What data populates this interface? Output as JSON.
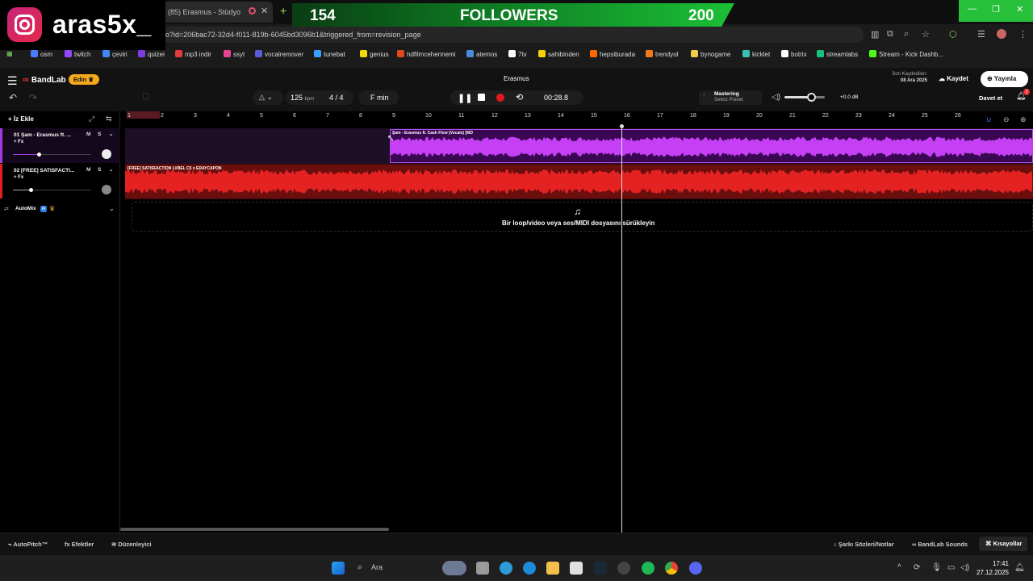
{
  "overlay": {
    "instagram_handle": "aras5x_",
    "followers_current": "154",
    "followers_label": "FOLLOWERS",
    "followers_goal": "200"
  },
  "browser": {
    "tab_title": "(85) Erasmus - Stüdyo",
    "url": "o?id=206bac72-32d4-f011-819b-6045bd3096b1&triggered_from=revision_page",
    "bookmarks": [
      "osm",
      "twitch",
      "çeviri",
      "quizei",
      "mp3 indir",
      "ssyt",
      "vocalremover",
      "tunebat",
      "genius",
      "hdfilmcehennemi",
      "atemos",
      "7tv",
      "sahibinden",
      "hepsiburada",
      "trendyol",
      "bynogame",
      "kicklet",
      "botrix",
      "streamlabs",
      "Stream - Kick Dashb..."
    ],
    "bookmark_colors": [
      "#4a7cff",
      "#9147ff",
      "#4285f4",
      "#7b3fe4",
      "#e33b3b",
      "#e84393",
      "#5b5bd6",
      "#3aa0ff",
      "#f5d90a",
      "#e24a1d",
      "#4a8cd6",
      "#ffffff",
      "#f4d20b",
      "#ff6a00",
      "#f27a1a",
      "#f2c94c",
      "#3ac0b0",
      "#ffffff",
      "#19c37d",
      "#53fc18"
    ]
  },
  "app": {
    "brand": "BandLab",
    "edit_badge": "Edin",
    "project_title": "Erasmus",
    "saved_label": "Son Kaydedilen:",
    "saved_date": "08 Ara 2025",
    "save_button": "Kaydet",
    "publish_button": "Yayınla",
    "invite_button": "Davet et",
    "notification_count": "2",
    "accent_color": "#f3a91b"
  },
  "transport": {
    "bpm": "125",
    "bpm_unit": "bpm",
    "time_signature": "4 / 4",
    "key": "F min",
    "time": "00:28.8",
    "mastering_label": "Mastering",
    "mastering_preset": "Select Preset",
    "volume_db": "+0.0 dB",
    "volume_level": 0.65
  },
  "left_panel": {
    "add_track": "İz Ekle",
    "tracks": [
      {
        "name": "01  Şam - Erasmus ft. ...",
        "fx": "+ Fx",
        "mute": "M",
        "solo": "S",
        "color": "#a33be0",
        "volume": 0.33
      },
      {
        "name": "02  [FREE] SATISFACTI...",
        "fx": "+ Fx",
        "mute": "M",
        "solo": "S",
        "color": "#e32020",
        "volume": 0.23
      }
    ],
    "automix": "AutoMix",
    "ai_badge": "AI"
  },
  "timeline": {
    "ruler": [
      "1",
      "2",
      "3",
      "4",
      "5",
      "6",
      "7",
      "8",
      "9",
      "10",
      "11",
      "12",
      "13",
      "14",
      "15",
      "16",
      "17",
      "18",
      "19",
      "20",
      "21",
      "22",
      "23",
      "24",
      "25",
      "26"
    ],
    "clip1_label": "Şam - Erasmus ft. Cash Flow (Vocals) [MD",
    "clip2_label": "[FREE] SATISFACTION LVBEL C5 x ERAYCAPON",
    "drop_text": "Bir loop/video veya ses/MIDI dosyasını sürükleyin"
  },
  "bottom_bar": {
    "autopitch": "AutoPitch™",
    "effects": "Efektler",
    "editor": "Düzenleyici",
    "lyrics": "Şarkı Sözleri/Notlar",
    "sounds": "BandLab Sounds",
    "shortcuts": "Kısayollar"
  },
  "taskbar": {
    "search": "Ara",
    "time": "17:41",
    "date": "27.12.2025"
  }
}
